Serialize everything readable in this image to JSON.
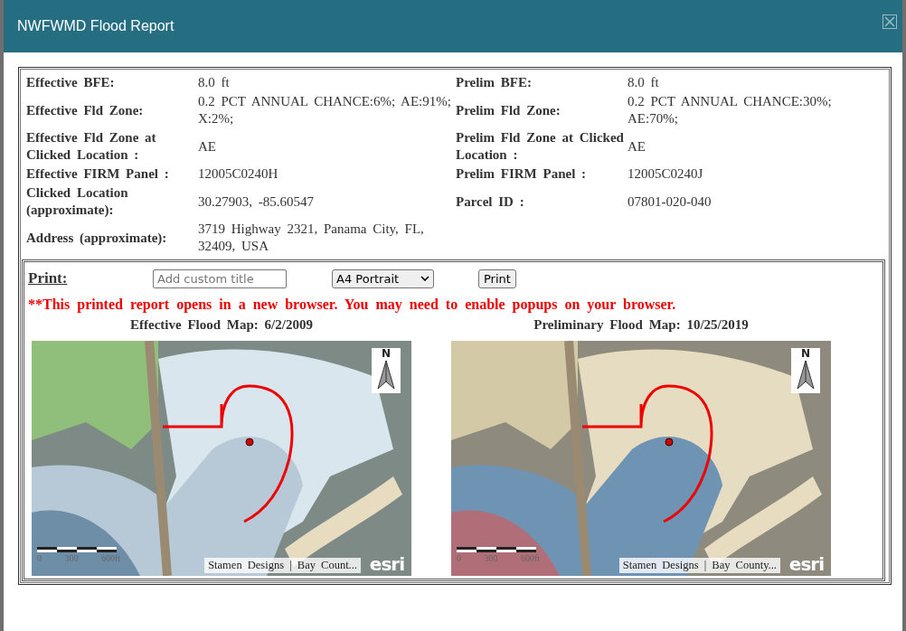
{
  "dialog": {
    "title": "NWFWMD Flood Report"
  },
  "details": [
    {
      "left": {
        "label": "Effective BFE:",
        "value": "8.0 ft"
      },
      "right": {
        "label": "Prelim BFE:",
        "value": "8.0 ft"
      }
    },
    {
      "left": {
        "label": "Effective Fld Zone:",
        "value": "0.2 PCT ANNUAL CHANCE:6%; AE:91%; X:2%;"
      },
      "right": {
        "label": "Prelim Fld Zone:",
        "value": "0.2 PCT ANNUAL CHANCE:30%; AE:70%;"
      }
    },
    {
      "left": {
        "label": "Effective Fld Zone at Clicked Location :",
        "value": "AE"
      },
      "right": {
        "label": "Prelim Fld Zone at Clicked Location :",
        "value": "AE"
      }
    },
    {
      "left": {
        "label": "Effective FIRM Panel :",
        "value": "12005C0240H"
      },
      "right": {
        "label": "Prelim FIRM Panel :",
        "value": "12005C0240J"
      }
    },
    {
      "left": {
        "label": "Clicked Location (approximate):",
        "value": "30.27903, -85.60547"
      },
      "right": {
        "label": "Parcel ID :",
        "value": "07801-020-040"
      }
    },
    {
      "left": {
        "label": "Address (approximate):",
        "value": "3719 Highway 2321, Panama City, FL, 32409, USA"
      }
    }
  ],
  "print": {
    "label": "Print:",
    "title_field": {
      "placeholder": "Add custom title"
    },
    "page_size": {
      "value": "A4 Portrait"
    },
    "button": "Print",
    "notice": "**This printed report opens in a new browser. You may need to enable popups on your browser."
  },
  "maps": [
    {
      "kind": "effective",
      "title": "Effective Flood Map: 6/2/2009",
      "north": "N",
      "scale_labels": [
        "0",
        "300",
        "600ft"
      ],
      "attribution": "Stamen Designs | Bay Count...",
      "logo": "esri"
    },
    {
      "kind": "preliminary",
      "title": "Preliminary Flood Map: 10/25/2019",
      "north": "N",
      "scale_labels": [
        "0",
        "300",
        "600ft"
      ],
      "attribution": "Stamen Designs | Bay County...",
      "logo": "esri"
    }
  ]
}
